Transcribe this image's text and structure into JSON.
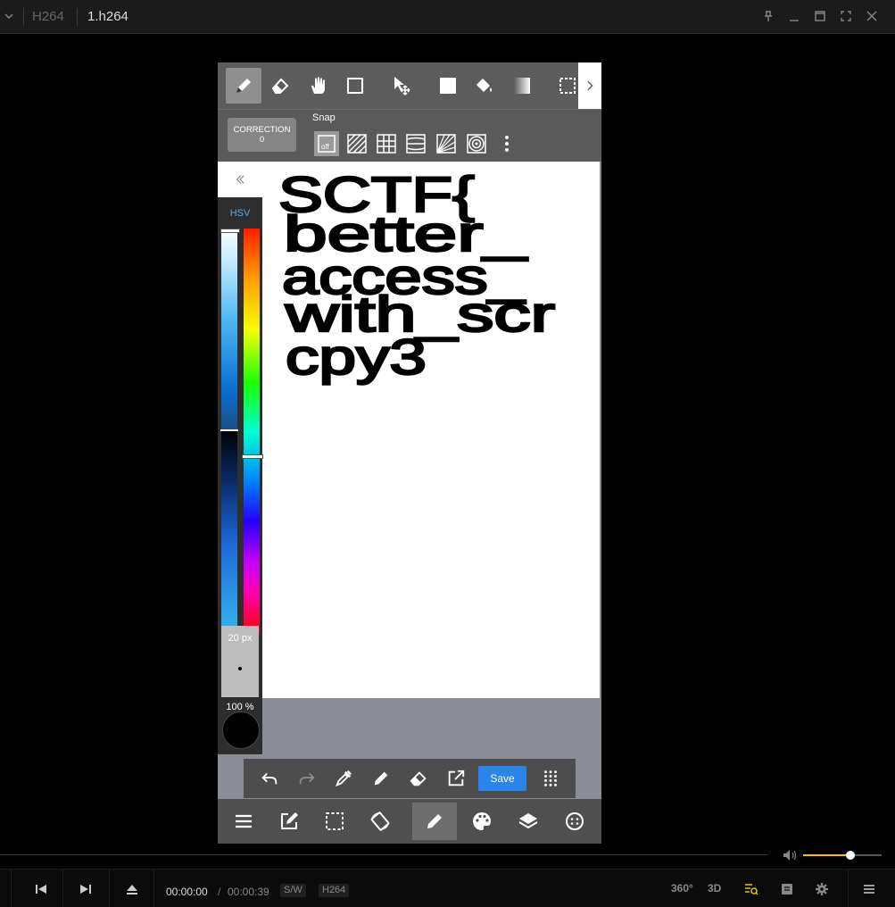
{
  "titlebar": {
    "tabs": [
      "H264",
      "1.h264"
    ],
    "window_buttons": [
      "pin-icon",
      "minimize-icon",
      "maximize-icon",
      "fullscreen-icon",
      "close-icon"
    ]
  },
  "app": {
    "top_tools": [
      "pen",
      "eraser",
      "hand",
      "shape",
      "move",
      "fill-color",
      "bucket",
      "gradient",
      "selection"
    ],
    "correction": {
      "label": "CORRECTION",
      "value": "0"
    },
    "snap": {
      "label": "Snap",
      "off_label": "off"
    },
    "canvas_text": [
      "SCTF{",
      "better_",
      "access_",
      "with_scr",
      "cpy3"
    ],
    "color_panel": {
      "mode": "HSV",
      "brush_size": "20 px",
      "opacity": "100 %",
      "current_color": "#000000"
    },
    "actions": {
      "save_label": "Save"
    }
  },
  "player": {
    "time_current": "00:00:00",
    "time_separator": "/",
    "time_total": "00:00:39",
    "badge_sw": "S/W",
    "badge_codec": "H264",
    "label_360": "360°",
    "label_3d": "3D",
    "volume_level": 0.6,
    "accent_color": "#f2c200"
  }
}
